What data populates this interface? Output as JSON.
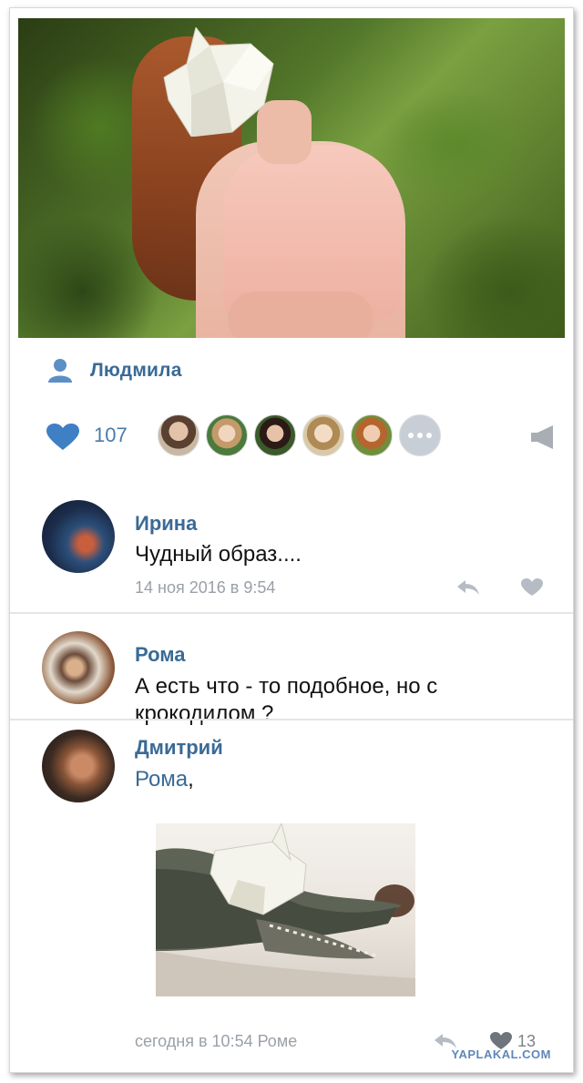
{
  "post": {
    "author": "Людмила",
    "likes_count": "107"
  },
  "comments": [
    {
      "name": "Ирина",
      "text": "Чудный образ....",
      "meta": "14 ноя 2016 в 9:54"
    },
    {
      "name": "Рома",
      "text": "А есть что - то подобное, но с крокодилом ?"
    },
    {
      "name": "Дмитрий",
      "mention": "Рома",
      "mention_suffix": ",",
      "meta": "сегодня в 10:54 Роме",
      "likes": "13"
    }
  ],
  "watermark": "YAPLAKAL.COM",
  "colors": {
    "accent": "#3a6a96",
    "like_heart": "#3f7fc4",
    "meta_text": "#9aa0a8"
  },
  "icons": [
    "person-icon",
    "heart-icon",
    "more-icon",
    "megaphone-icon",
    "reply-icon",
    "like-icon"
  ]
}
